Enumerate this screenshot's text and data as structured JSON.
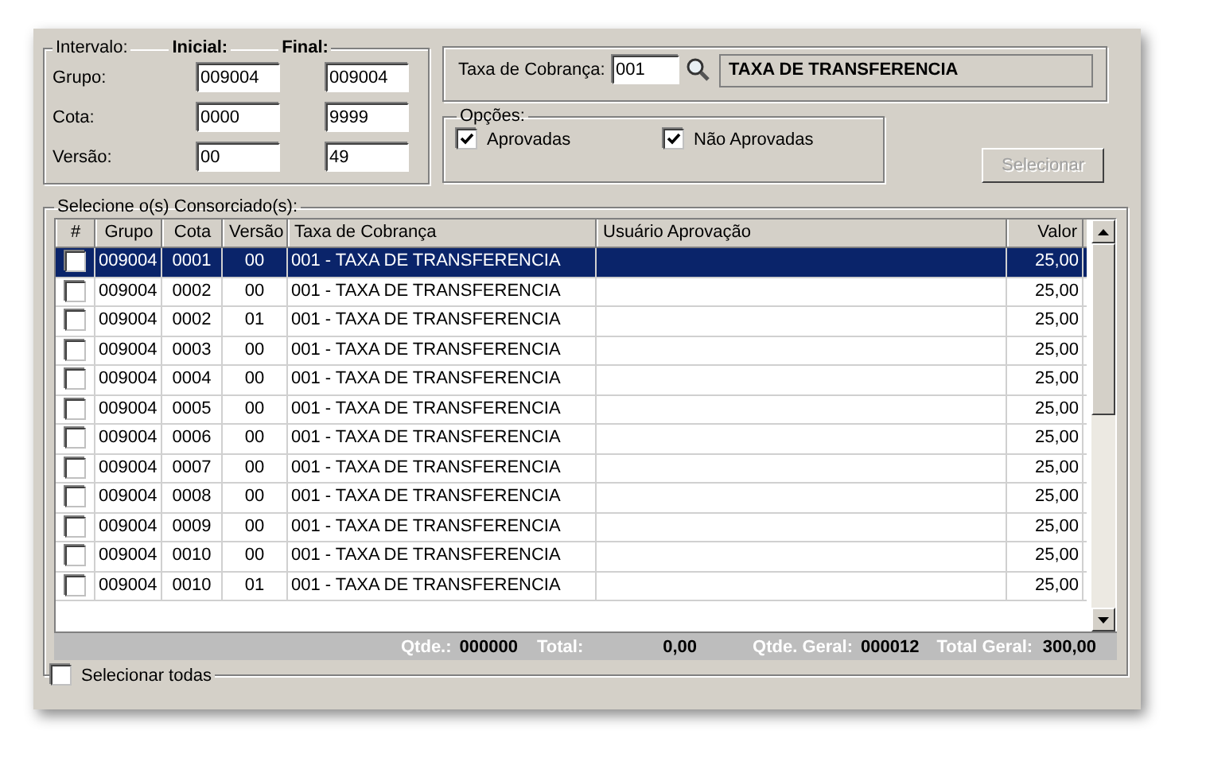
{
  "interval": {
    "legend": "Intervalo:",
    "initial_heading": "Inicial:",
    "final_heading": "Final:",
    "rows": [
      {
        "label": "Grupo:",
        "initial": "009004",
        "final": "009004"
      },
      {
        "label": "Cota:",
        "initial": "0000",
        "final": "9999"
      },
      {
        "label": "Versão:",
        "initial": "00",
        "final": "49"
      }
    ]
  },
  "fee": {
    "label": "Taxa de Cobrança:",
    "code": "001",
    "description": "TAXA DE TRANSFERENCIA"
  },
  "options": {
    "legend": "Opções:",
    "items": [
      {
        "label": "Aprovadas",
        "checked": true
      },
      {
        "label": "Não Aprovadas",
        "checked": true
      }
    ]
  },
  "select_button": {
    "label": "Selecionar",
    "disabled": true
  },
  "consortium": {
    "legend": "Selecione o(s) Consorciado(s):",
    "columns": [
      "#",
      "Grupo",
      "Cota",
      "Versão",
      "Taxa de Cobrança",
      "Usuário Aprovação",
      "Valor"
    ],
    "rows": [
      {
        "selected": true,
        "checked": false,
        "grupo": "009004",
        "cota": "0001",
        "versao": "00",
        "taxa": "001 - TAXA DE TRANSFERENCIA",
        "valor": "25,00"
      },
      {
        "selected": false,
        "checked": false,
        "grupo": "009004",
        "cota": "0002",
        "versao": "00",
        "taxa": "001 - TAXA DE TRANSFERENCIA",
        "valor": "25,00"
      },
      {
        "selected": false,
        "checked": false,
        "grupo": "009004",
        "cota": "0002",
        "versao": "01",
        "taxa": "001 - TAXA DE TRANSFERENCIA",
        "valor": "25,00"
      },
      {
        "selected": false,
        "checked": false,
        "grupo": "009004",
        "cota": "0003",
        "versao": "00",
        "taxa": "001 - TAXA DE TRANSFERENCIA",
        "valor": "25,00"
      },
      {
        "selected": false,
        "checked": false,
        "grupo": "009004",
        "cota": "0004",
        "versao": "00",
        "taxa": "001 - TAXA DE TRANSFERENCIA",
        "valor": "25,00"
      },
      {
        "selected": false,
        "checked": false,
        "grupo": "009004",
        "cota": "0005",
        "versao": "00",
        "taxa": "001 - TAXA DE TRANSFERENCIA",
        "valor": "25,00"
      },
      {
        "selected": false,
        "checked": false,
        "grupo": "009004",
        "cota": "0006",
        "versao": "00",
        "taxa": "001 - TAXA DE TRANSFERENCIA",
        "valor": "25,00"
      },
      {
        "selected": false,
        "checked": false,
        "grupo": "009004",
        "cota": "0007",
        "versao": "00",
        "taxa": "001 - TAXA DE TRANSFERENCIA",
        "valor": "25,00"
      },
      {
        "selected": false,
        "checked": false,
        "grupo": "009004",
        "cota": "0008",
        "versao": "00",
        "taxa": "001 - TAXA DE TRANSFERENCIA",
        "valor": "25,00"
      },
      {
        "selected": false,
        "checked": false,
        "grupo": "009004",
        "cota": "0009",
        "versao": "00",
        "taxa": "001 - TAXA DE TRANSFERENCIA",
        "valor": "25,00"
      },
      {
        "selected": false,
        "checked": false,
        "grupo": "009004",
        "cota": "0010",
        "versao": "00",
        "taxa": "001 - TAXA DE TRANSFERENCIA",
        "valor": "25,00"
      },
      {
        "selected": false,
        "checked": false,
        "grupo": "009004",
        "cota": "0010",
        "versao": "01",
        "taxa": "001 - TAXA DE TRANSFERENCIA",
        "valor": "25,00"
      }
    ],
    "totals": [
      {
        "label": "Qtde.:",
        "value": "000000"
      },
      {
        "label": "Total:",
        "value": "0,00"
      },
      {
        "label": "Qtde. Geral:",
        "value": "000012"
      },
      {
        "label": "Total Geral:",
        "value": "300,00"
      }
    ]
  },
  "select_all": {
    "label": "Selecionar todas",
    "checked": false
  }
}
